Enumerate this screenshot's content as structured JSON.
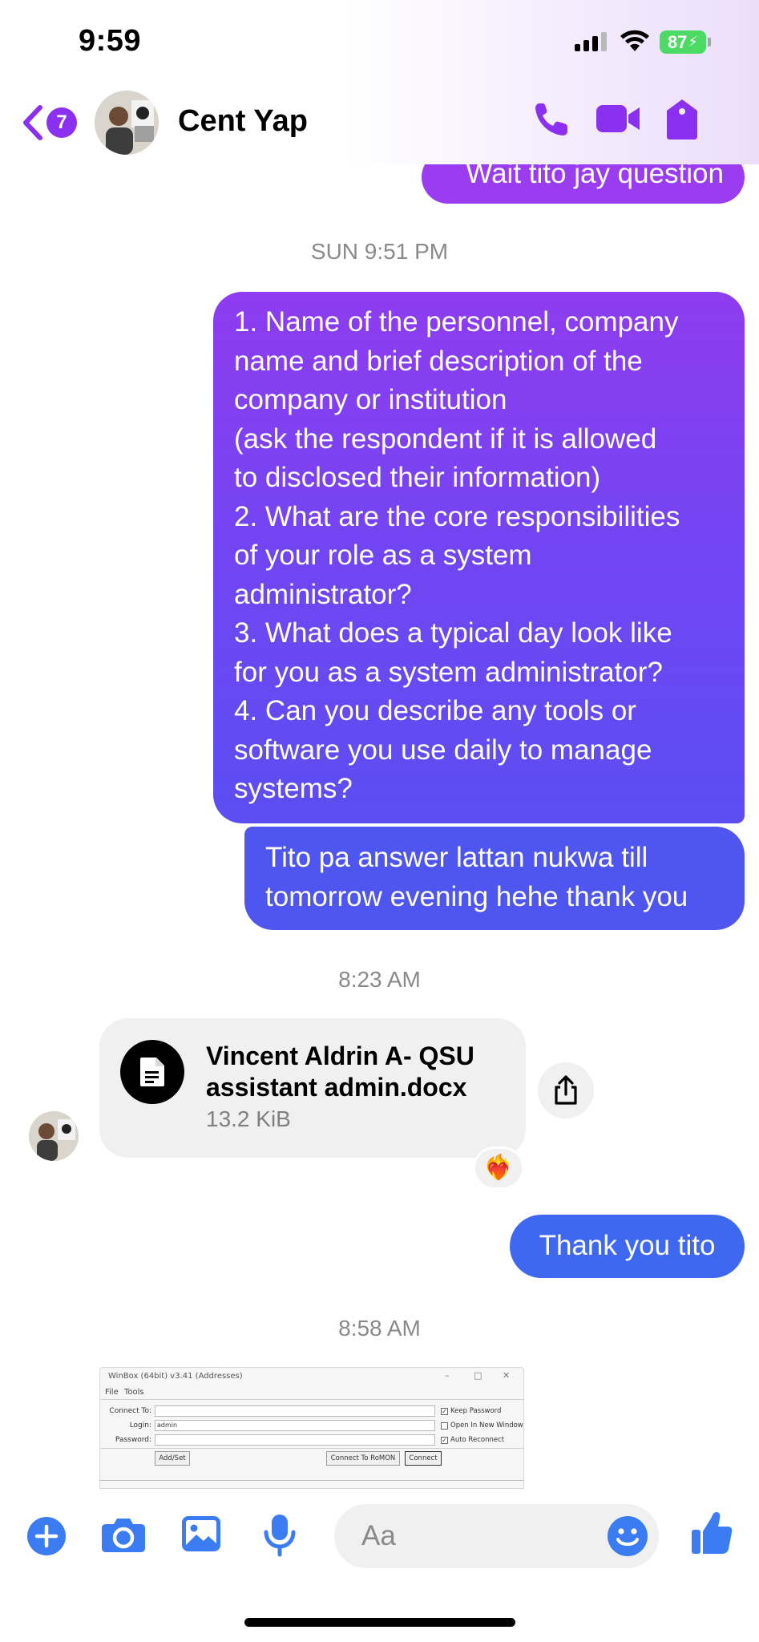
{
  "status_bar": {
    "time": "9:59",
    "battery": "87"
  },
  "header": {
    "unread_count": "7",
    "contact_name": "Cent Yap"
  },
  "messages": {
    "top_partial": "Wait tito jay question",
    "timestamp_1": "SUN 9:51 PM",
    "questions_lines": [
      "1. Name of the personnel, company",
      "name and brief description of the",
      "company or institution",
      "(ask the respondent if it is allowed",
      "to disclosed their information)",
      "2. What are the core responsibilities",
      "of your role as a system",
      "administrator?",
      "3. What does a typical day look like",
      "for you as a system administrator?",
      "4. Can you describe any tools or",
      "software you use daily to manage",
      "systems?"
    ],
    "followup_lines": [
      "Tito pa answer lattan nukwa till",
      "tomorrow evening hehe thank you"
    ],
    "timestamp_2": "8:23 AM",
    "file": {
      "name_lines": [
        "Vincent Aldrin A- QSU",
        "assistant admin.docx"
      ],
      "size": "13.2 KiB",
      "reaction": "❤️‍🔥"
    },
    "thanks": "Thank you tito",
    "timestamp_3": "8:58 AM"
  },
  "winbox_preview": {
    "title": "WinBox (64bit) v3.41 (Addresses)",
    "menu_file": "File",
    "menu_tools": "Tools",
    "connect_to_label": "Connect To:",
    "login_label": "Login:",
    "login_value": "admin",
    "password_label": "Password:",
    "keep_password": "Keep Password",
    "open_new_window": "Open In New Window",
    "auto_reconnect": "Auto Reconnect",
    "add_set": "Add/Set",
    "connect_romon": "Connect To RoMON",
    "connect": "Connect"
  },
  "composer": {
    "placeholder": "Aa"
  },
  "colors": {
    "accent_purple": "#8b2ff0",
    "bubble_purple": "#9a3df0",
    "bubble_blue": "#3f68f0",
    "composer_blue": "#3b7cf3"
  }
}
